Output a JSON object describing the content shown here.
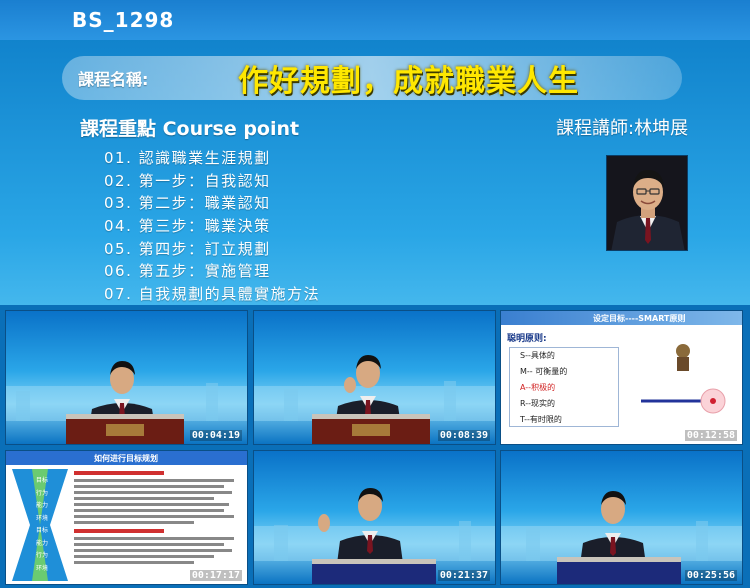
{
  "header": {
    "code": "BS_1298",
    "title_label": "課程名稱:",
    "course_title": "作好規劃，成就職業人生",
    "point_heading": "課程重點 Course point",
    "instructor": "課程講師:林坤展"
  },
  "outline": [
    "01. 認識職業生涯規劃",
    "02. 第一步：自我認知",
    "03. 第二步：職業認知",
    "04. 第三步：職業決策",
    "05. 第四步：訂立規劃",
    "06. 第五步：實施管理",
    "07. 自我規劃的具體實施方法"
  ],
  "thumbnails": [
    {
      "time": "00:04:19"
    },
    {
      "time": "00:08:39"
    },
    {
      "time": "00:12:58",
      "slide_title": "设定目标----SMART原则",
      "box_title": "聪明原则:",
      "items": [
        "S--具体的",
        "M-- 可衡量的",
        "A--积极的",
        "R--现实的",
        "T--有时限的"
      ]
    },
    {
      "time": "00:17:17",
      "slide_title": "如何进行目标规划",
      "steps": [
        "目标",
        "行为",
        "能力",
        "环境",
        "目标",
        "能力",
        "行为",
        "环境"
      ]
    },
    {
      "time": "00:21:37"
    },
    {
      "time": "00:25:56"
    }
  ],
  "colors": {
    "accent": "#ffe700",
    "background": "#1a8fd8"
  }
}
